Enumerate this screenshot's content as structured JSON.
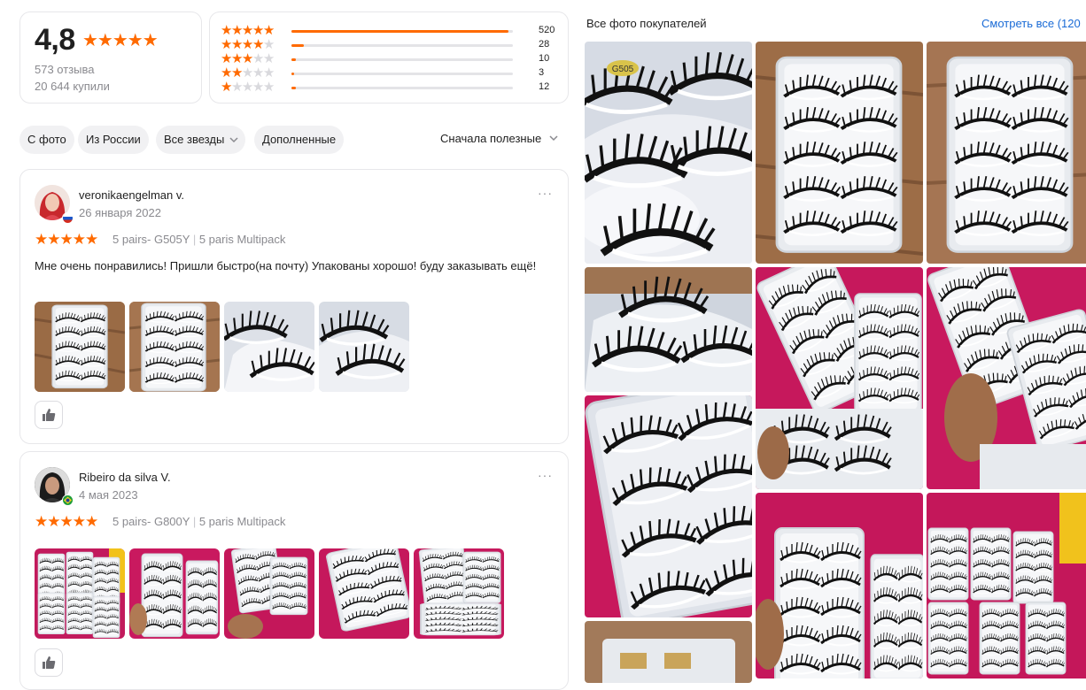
{
  "summary": {
    "rating": "4,8",
    "stars": "★★★★★",
    "reviews_count": "573 отзыва",
    "bought_count": "20 644 купили"
  },
  "histogram": [
    {
      "stars": 5,
      "count": "520",
      "fraction": 0.98
    },
    {
      "stars": 4,
      "count": "28",
      "fraction": 0.055
    },
    {
      "stars": 3,
      "count": "10",
      "fraction": 0.02
    },
    {
      "stars": 2,
      "count": "3",
      "fraction": 0.01
    },
    {
      "stars": 1,
      "count": "12",
      "fraction": 0.02
    }
  ],
  "filters": {
    "photo": "С фото",
    "russia": "Из России",
    "all_stars": "Все звезды",
    "supplemented": "Дополненные",
    "sort": "Сначала полезные"
  },
  "reviews": [
    {
      "author": "veronikaengelman v.",
      "date": "26 января 2022",
      "stars": "★★★★★",
      "variant_a": "5 pairs- G505Y",
      "variant_sep": "|",
      "variant_b": "5 paris Multipack",
      "text": "Мне очень понравились! Пришли быстро(на почту) Упакованы хорошо! буду заказывать ещё!",
      "more": "···"
    },
    {
      "author": "Ribeiro da silva V.",
      "date": "4 мая 2023",
      "stars": "★★★★★",
      "variant_a": "5 pairs- G800Y",
      "variant_sep": "|",
      "variant_b": "5 paris Multipack",
      "more": "···"
    }
  ],
  "gallery": {
    "title": "Все фото покупателей",
    "see_all": "Смотреть все (120"
  },
  "photo_labels": {
    "box_code": "G505"
  },
  "colors": {
    "accent": "#ff6a00",
    "link": "#1a6bd6",
    "magenta_bg": "#c8175d",
    "tray": "#e9ecef"
  },
  "icons": {
    "like": "thumbs-up-icon",
    "chevron": "chevron-down-icon",
    "more": "more-dots-icon"
  }
}
